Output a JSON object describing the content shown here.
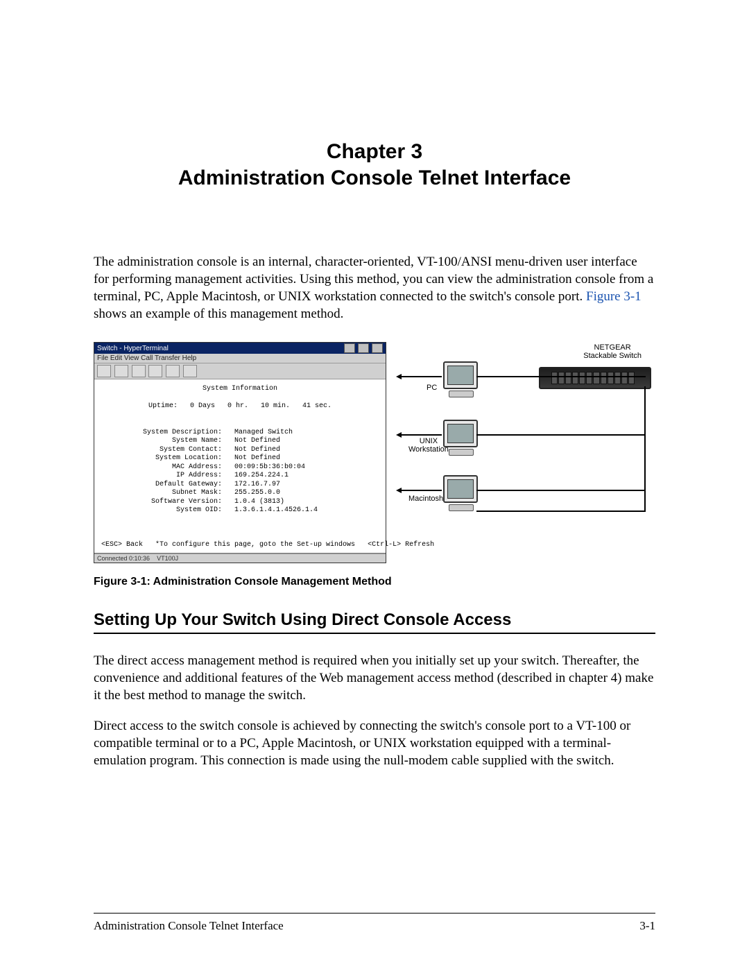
{
  "chapter": {
    "line1": "Chapter 3",
    "line2": "Administration Console Telnet Interface"
  },
  "intro": {
    "before_link": "The administration console is an internal, character-oriented, VT-100/ANSI menu-driven user interface for performing management activities. Using this method, you can view the administration console from a terminal, PC, Apple Macintosh, or UNIX workstation connected to the switch's console port. ",
    "link_text": "Figure 3-1",
    "after_link": " shows an example of this management method."
  },
  "figure": {
    "terminal": {
      "title": "Switch - HyperTerminal",
      "menubar": "File  Edit  View  Call  Transfer  Help",
      "screen_title": "System Information",
      "uptime_line": "Uptime:   0 Days   0 hr.   10 min.   41 sec.",
      "rows": [
        {
          "label": "System Description:",
          "value": "Managed Switch"
        },
        {
          "label": "System Name:",
          "value": "Not Defined"
        },
        {
          "label": "System Contact:",
          "value": "Not Defined"
        },
        {
          "label": "System Location:",
          "value": "Not Defined"
        },
        {
          "label": "MAC Address:",
          "value": "00:09:5b:36:b0:04"
        },
        {
          "label": "IP Address:",
          "value": "169.254.224.1"
        },
        {
          "label": "Default Gateway:",
          "value": "172.16.7.97"
        },
        {
          "label": "Subnet Mask:",
          "value": "255.255.0.0"
        },
        {
          "label": "Software Version:",
          "value": "1.0.4 (3813)"
        },
        {
          "label": "System OID:",
          "value": "1.3.6.1.4.1.4526.1.4"
        }
      ],
      "help_line": "<ESC> Back   *To configure this page, goto the Set-up windows   <Ctrl-L> Refresh",
      "status_left": "Connected 0:10:36",
      "status_right": "VT100J"
    },
    "diagram": {
      "switch_label_line1": "NETGEAR",
      "switch_label_line2": "Stackable Switch",
      "pc_label": "PC",
      "unix_label_line1": "UNIX",
      "unix_label_line2": "Workstation",
      "mac_label": "Macintosh"
    },
    "caption": "Figure 3-1:  Administration Console Management Method"
  },
  "section_heading": "Setting Up Your Switch Using Direct Console Access",
  "para1": "The direct access management method is required when you initially set up your switch. Thereafter, the convenience and additional features of the Web management access method (described in chapter 4) make it the best method to manage the switch.",
  "para2": "Direct access to the switch console is achieved by connecting the switch's console port to a VT-100 or compatible terminal or to a PC, Apple Macintosh, or UNIX workstation equipped with a terminal-emulation program. This connection is made using the null-modem cable supplied with the switch.",
  "footer": {
    "left": "Administration Console Telnet Interface",
    "right": "3-1"
  }
}
